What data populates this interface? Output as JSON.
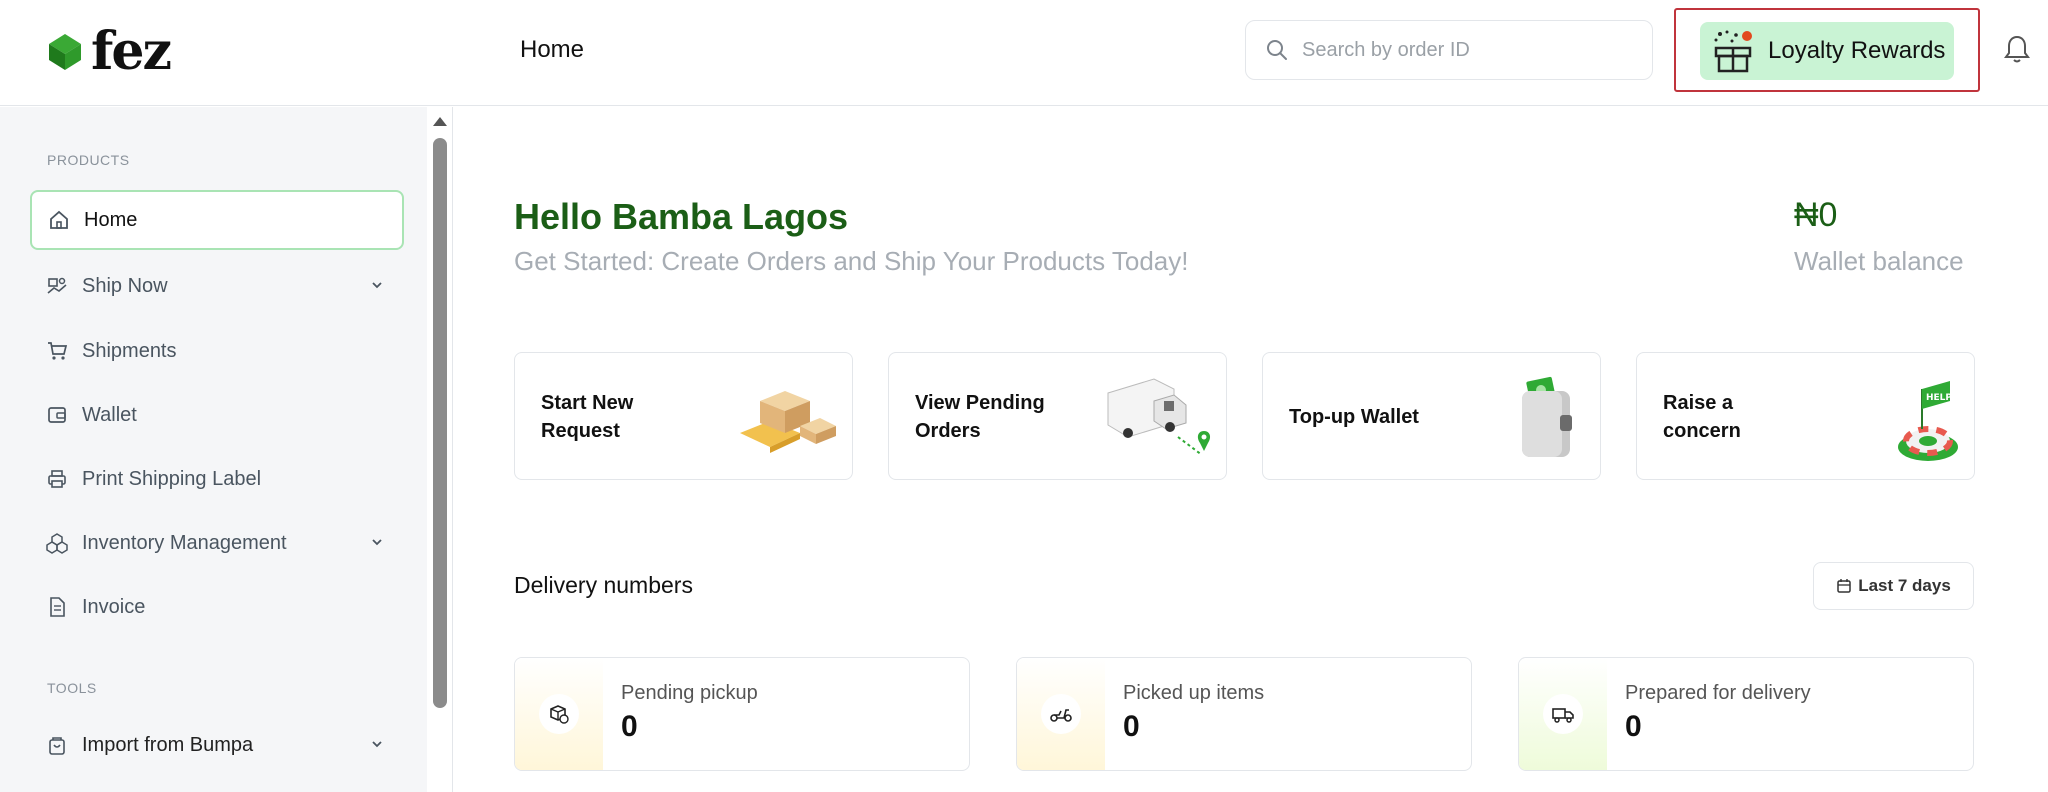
{
  "app": {
    "logo_text": "fez",
    "page_title": "Home"
  },
  "header": {
    "search_placeholder": "Search by order ID",
    "loyalty_label": "Loyalty Rewards",
    "icons": [
      "search-icon",
      "gift-icon",
      "bell-icon"
    ]
  },
  "sidebar": {
    "products_label": "PRODUCTS",
    "tools_label": "TOOLS",
    "items": [
      {
        "label": "Home",
        "icon": "home-icon",
        "active": true
      },
      {
        "label": "Ship Now",
        "icon": "ship-icon",
        "expandable": true
      },
      {
        "label": "Shipments",
        "icon": "cart-icon"
      },
      {
        "label": "Wallet",
        "icon": "wallet-icon"
      },
      {
        "label": "Print Shipping Label",
        "icon": "printer-icon"
      },
      {
        "label": "Inventory Management",
        "icon": "boxes-icon",
        "expandable": true
      },
      {
        "label": "Invoice",
        "icon": "document-icon"
      }
    ],
    "tools": [
      {
        "label": "Import from Bumpa",
        "icon": "bag-icon",
        "expandable": true
      }
    ]
  },
  "main": {
    "greeting": "Hello Bamba Lagos",
    "subtitle": "Get Started: Create Orders and Ship Your Products Today!",
    "wallet_amount": "₦0",
    "wallet_label": "Wallet balance",
    "cards": [
      {
        "label": "Start New Request",
        "art": "boxes-illustration"
      },
      {
        "label": "View Pending Orders",
        "art": "van-illustration"
      },
      {
        "label": "Top-up Wallet",
        "art": "wallet-illustration"
      },
      {
        "label": "Raise a concern",
        "art": "help-buoy-illustration"
      }
    ],
    "delivery_title": "Delivery numbers",
    "range_label": "Last 7 days",
    "stats": [
      {
        "label": "Pending pickup",
        "value": "0",
        "icon": "package-clock-icon"
      },
      {
        "label": "Picked up items",
        "value": "0",
        "icon": "scooter-icon"
      },
      {
        "label": "Prepared for delivery",
        "value": "0",
        "icon": "truck-icon"
      }
    ]
  },
  "colors": {
    "brand_green": "#1b5e16",
    "loyalty_bg": "#c9f3d4",
    "highlight_frame": "#c0343c"
  }
}
